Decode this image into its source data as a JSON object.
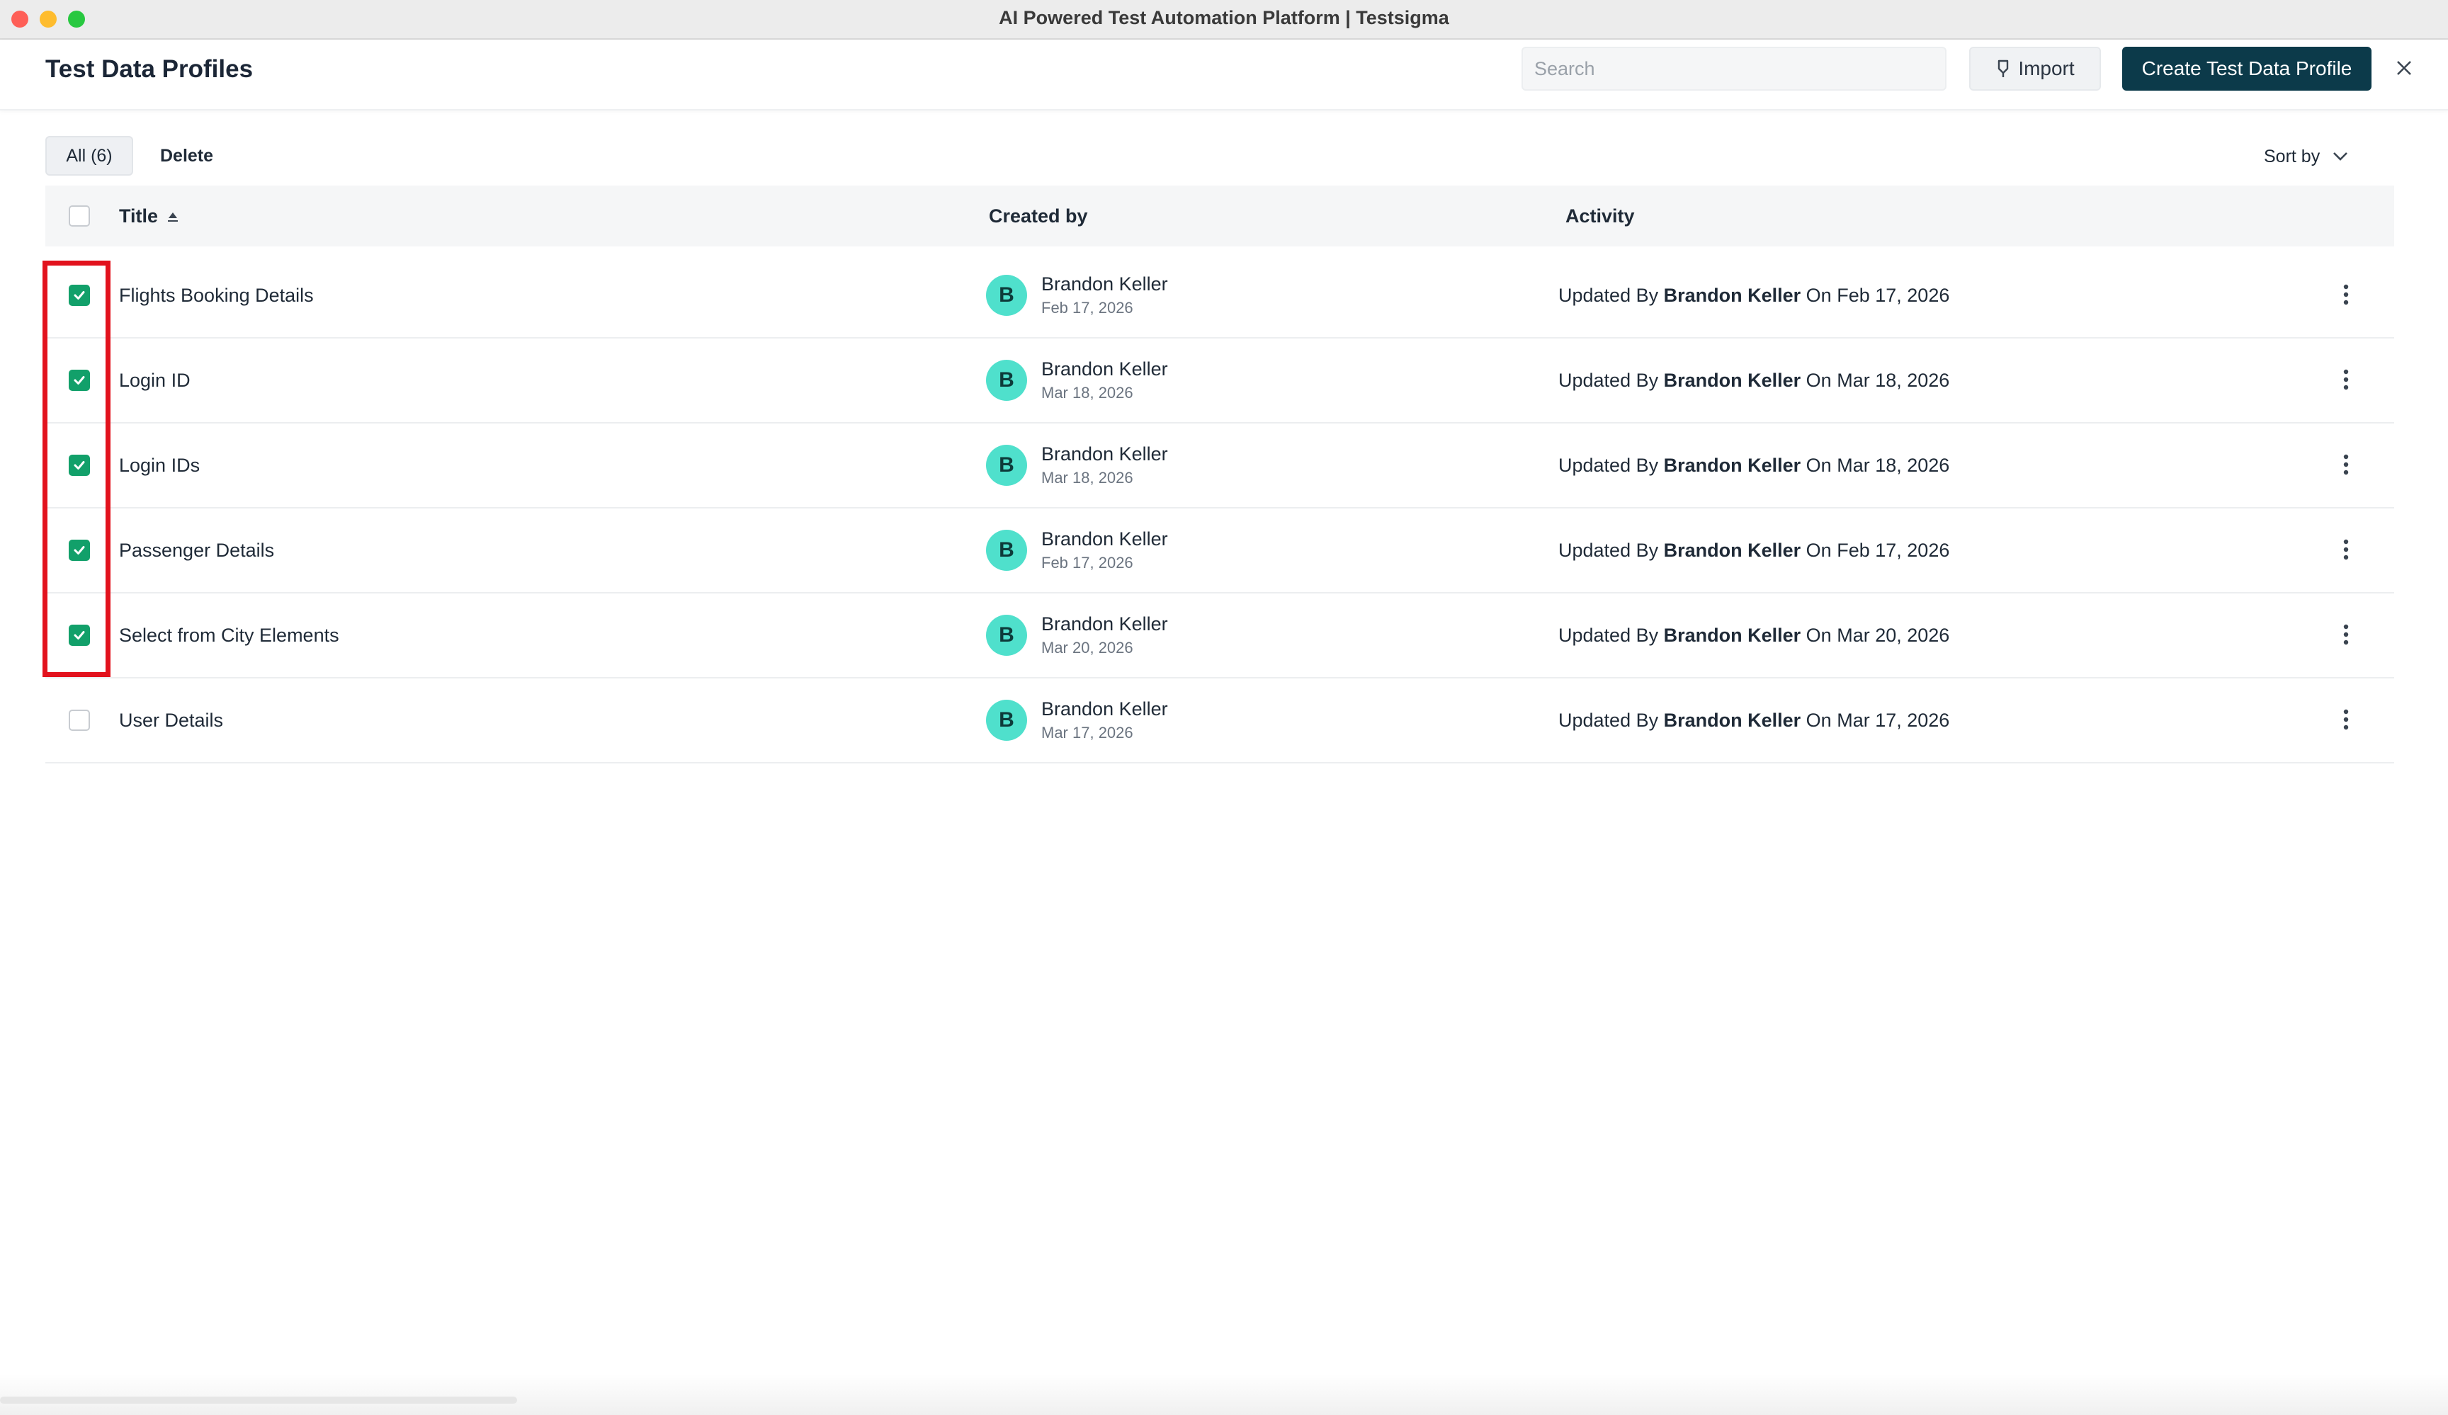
{
  "window": {
    "title": "AI Powered Test Automation Platform | Testsigma"
  },
  "header": {
    "page_title": "Test Data Profiles",
    "search_placeholder": "Search",
    "import_label": "Import",
    "create_label": "Create Test Data Profile"
  },
  "toolbar": {
    "tab_all": "All (6)",
    "delete_label": "Delete",
    "sort_label": "Sort by"
  },
  "table": {
    "columns": {
      "title": "Title",
      "created_by": "Created by",
      "activity": "Activity"
    },
    "activity_prefix": "Updated By",
    "activity_on": "On",
    "rows": [
      {
        "checked": true,
        "title": "Flights Booking Details",
        "avatar": "B",
        "creator": "Brandon Keller",
        "created": "Feb 17, 2026",
        "updated_by": "Brandon Keller",
        "updated_on": "Feb 17, 2026"
      },
      {
        "checked": true,
        "title": "Login ID",
        "avatar": "B",
        "creator": "Brandon Keller",
        "created": "Mar 18, 2026",
        "updated_by": "Brandon Keller",
        "updated_on": "Mar 18, 2026"
      },
      {
        "checked": true,
        "title": "Login IDs",
        "avatar": "B",
        "creator": "Brandon Keller",
        "created": "Mar 18, 2026",
        "updated_by": "Brandon Keller",
        "updated_on": "Mar 18, 2026"
      },
      {
        "checked": true,
        "title": "Passenger Details",
        "avatar": "B",
        "creator": "Brandon Keller",
        "created": "Feb 17, 2026",
        "updated_by": "Brandon Keller",
        "updated_on": "Feb 17, 2026"
      },
      {
        "checked": true,
        "title": "Select from City Elements",
        "avatar": "B",
        "creator": "Brandon Keller",
        "created": "Mar 20, 2026",
        "updated_by": "Brandon Keller",
        "updated_on": "Mar 20, 2026"
      },
      {
        "checked": false,
        "title": "User Details",
        "avatar": "B",
        "creator": "Brandon Keller",
        "created": "Mar 17, 2026",
        "updated_by": "Brandon Keller",
        "updated_on": "Mar 17, 2026"
      }
    ]
  },
  "colors": {
    "accent": "#12a06a",
    "primary_button": "#0c3a4a",
    "avatar": "#4fe0cc",
    "highlight": "#e2121d"
  }
}
